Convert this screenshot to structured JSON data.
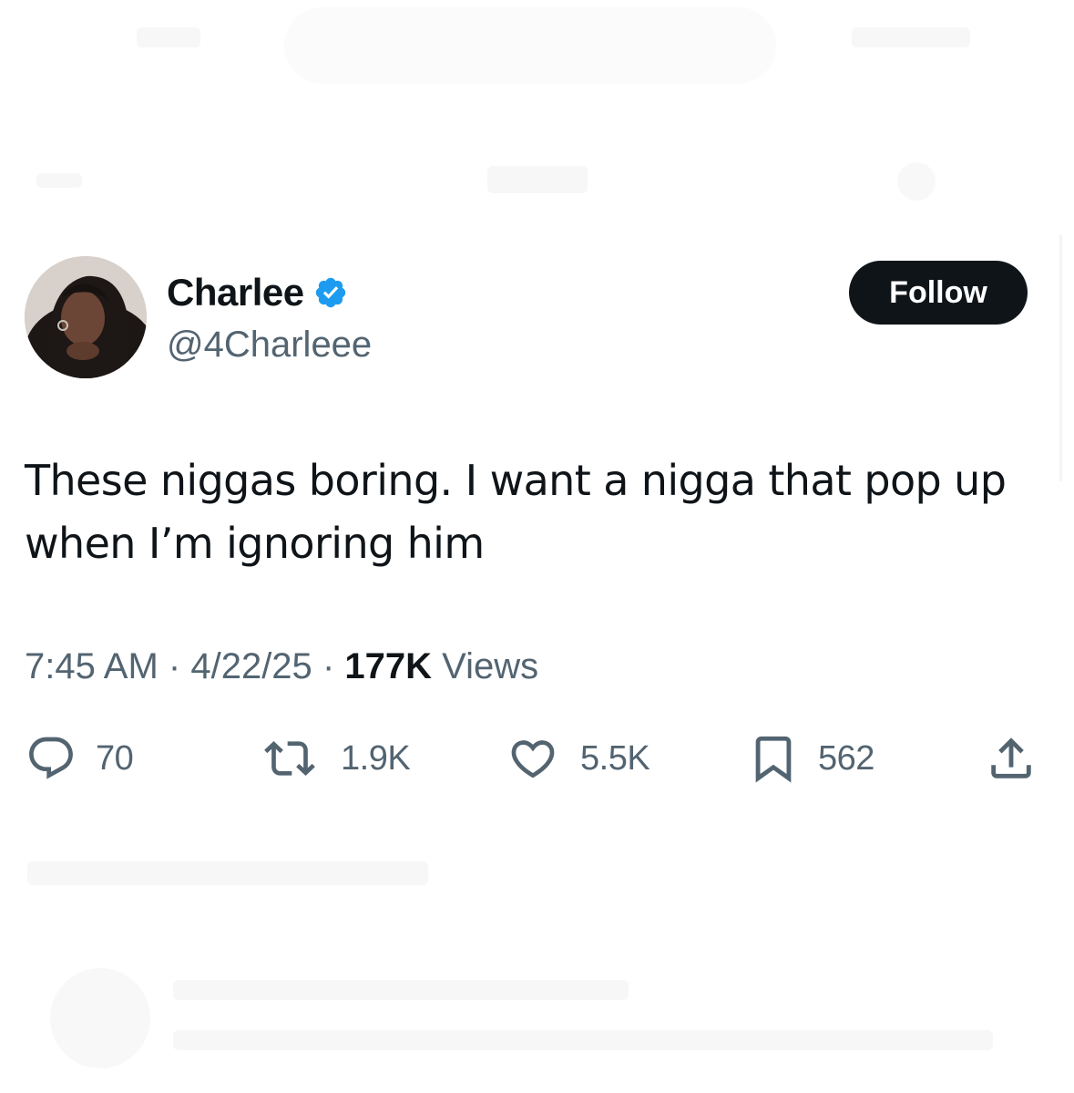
{
  "author": {
    "display_name": "Charlee",
    "handle": "@4Charleee",
    "verified": true,
    "verified_color": "#1d9bf0",
    "avatar_icon": "profile-photo"
  },
  "follow_button": {
    "label": "Follow"
  },
  "tweet": {
    "text": "These niggas boring. I want a nigga that pop up when I’m ignoring him"
  },
  "meta": {
    "time": "7:45 AM",
    "separator": "·",
    "date": "4/22/25",
    "views_count": "177K",
    "views_label": "Views"
  },
  "actions": {
    "reply": {
      "icon": "reply-icon",
      "count": "70"
    },
    "repost": {
      "icon": "repost-icon",
      "count": "1.9K"
    },
    "like": {
      "icon": "heart-icon",
      "count": "5.5K"
    },
    "bookmark": {
      "icon": "bookmark-icon",
      "count": "562"
    },
    "share": {
      "icon": "share-icon"
    }
  },
  "colors": {
    "text_primary": "#0f1419",
    "text_secondary": "#536471",
    "button_bg": "#0f1419"
  }
}
